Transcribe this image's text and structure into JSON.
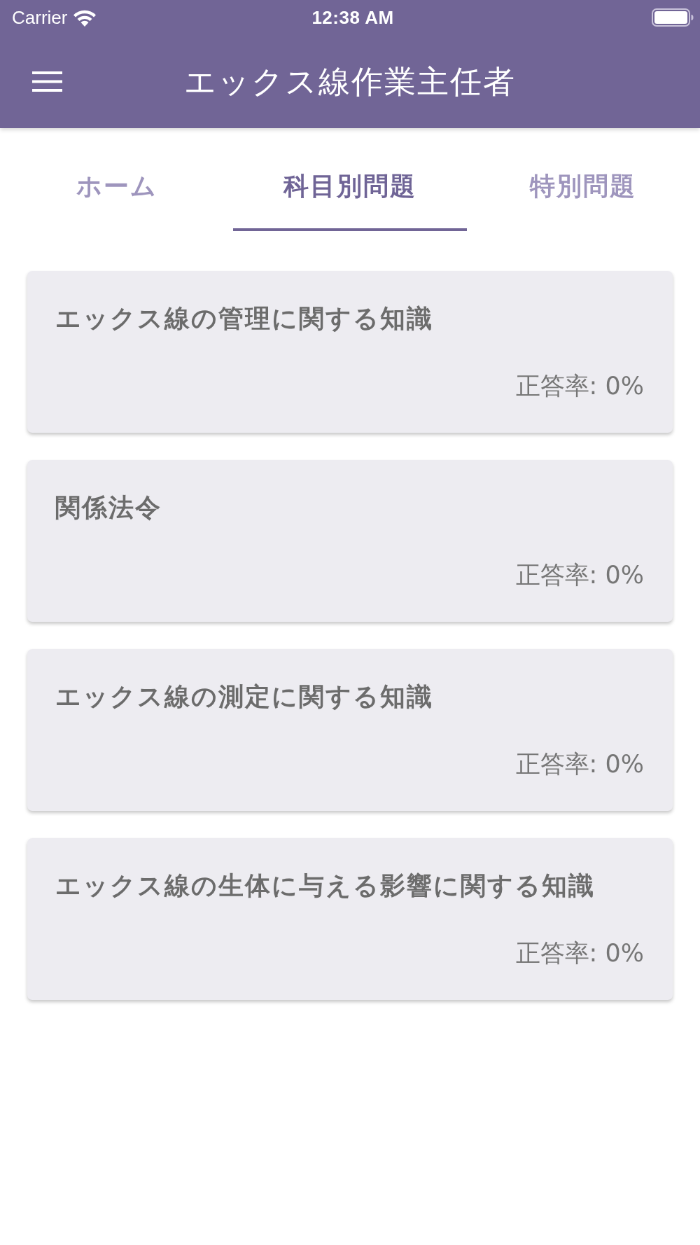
{
  "status_bar": {
    "carrier": "Carrier",
    "time": "12:38 AM"
  },
  "app_bar": {
    "title": "エックス線作業主任者"
  },
  "tabs": [
    {
      "label": "ホーム",
      "selected": false
    },
    {
      "label": "科目別問題",
      "selected": true
    },
    {
      "label": "特別問題",
      "selected": false
    }
  ],
  "cards": [
    {
      "title": "エックス線の管理に関する知識",
      "score": "正答率: 0%"
    },
    {
      "title": "関係法令",
      "score": "正答率: 0%"
    },
    {
      "title": "エックス線の測定に関する知識",
      "score": "正答率: 0%"
    },
    {
      "title": "エックス線の生体に与える影響に関する知識",
      "score": "正答率: 0%"
    }
  ]
}
